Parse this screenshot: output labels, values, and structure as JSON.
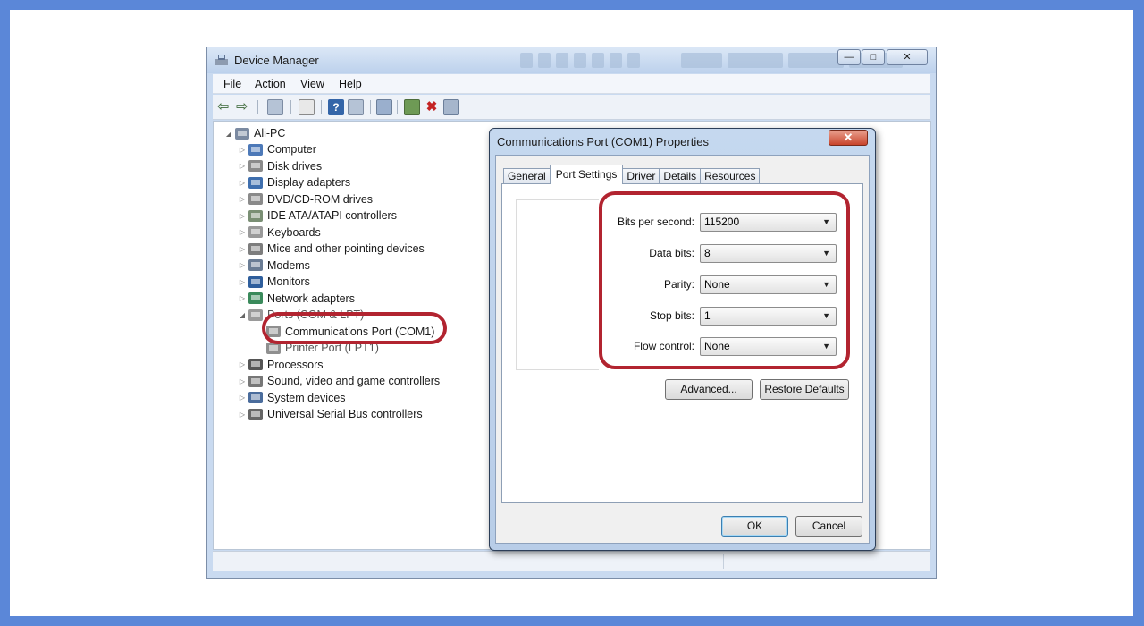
{
  "device_manager": {
    "title": "Device Manager",
    "window_controls": [
      "—",
      "□",
      "✕"
    ],
    "menu": [
      "File",
      "Action",
      "View",
      "Help"
    ],
    "tree": {
      "root": "Ali-PC",
      "categories": [
        {
          "label": "Computer",
          "icon": "computer-icon",
          "color": "#4d79b8"
        },
        {
          "label": "Disk drives",
          "icon": "disk-drive-icon",
          "color": "#8a8a8a"
        },
        {
          "label": "Display adapters",
          "icon": "display-adapter-icon",
          "color": "#3f6fae"
        },
        {
          "label": "DVD/CD-ROM drives",
          "icon": "dvd-drive-icon",
          "color": "#8a8a8a"
        },
        {
          "label": "IDE ATA/ATAPI controllers",
          "icon": "ide-controller-icon",
          "color": "#7a8f74"
        },
        {
          "label": "Keyboards",
          "icon": "keyboard-icon",
          "color": "#9a9a9a"
        },
        {
          "label": "Mice and other pointing devices",
          "icon": "mouse-icon",
          "color": "#7d7d7d"
        },
        {
          "label": "Modems",
          "icon": "modem-icon",
          "color": "#6a7c94"
        },
        {
          "label": "Monitors",
          "icon": "monitor-icon",
          "color": "#2f5e9c"
        },
        {
          "label": "Network adapters",
          "icon": "network-adapter-icon",
          "color": "#3a8a5b"
        },
        {
          "label": "Ports (COM & LPT)",
          "icon": "port-icon",
          "color": "#9a9a9a"
        }
      ],
      "port_children": [
        {
          "label": "Communications Port (COM1)",
          "icon": "serial-port-icon",
          "color": "#8f8f8f"
        },
        {
          "label": "Printer Port (LPT1)",
          "icon": "printer-port-icon",
          "color": "#8f8f8f"
        }
      ],
      "categories_after": [
        {
          "label": "Processors",
          "icon": "processor-icon",
          "color": "#555555"
        },
        {
          "label": "Sound, video and game controllers",
          "icon": "sound-icon",
          "color": "#777777"
        },
        {
          "label": "System devices",
          "icon": "system-device-icon",
          "color": "#4a6c9c"
        },
        {
          "label": "Universal Serial Bus controllers",
          "icon": "usb-icon",
          "color": "#666666"
        }
      ]
    }
  },
  "properties_dialog": {
    "title": "Communications Port (COM1) Properties",
    "close_glyph": "✕",
    "tabs": [
      "General",
      "Port Settings",
      "Driver",
      "Details",
      "Resources"
    ],
    "active_tab": "Port Settings",
    "fields": [
      {
        "label": "Bits per second:",
        "value": "115200"
      },
      {
        "label": "Data bits:",
        "value": "8"
      },
      {
        "label": "Parity:",
        "value": "None"
      },
      {
        "label": "Stop bits:",
        "value": "1"
      },
      {
        "label": "Flow control:",
        "value": "None"
      }
    ],
    "advanced_button": "Advanced...",
    "restore_button": "Restore Defaults",
    "ok_button": "OK",
    "cancel_button": "Cancel"
  },
  "highlight_color": "#b22430"
}
